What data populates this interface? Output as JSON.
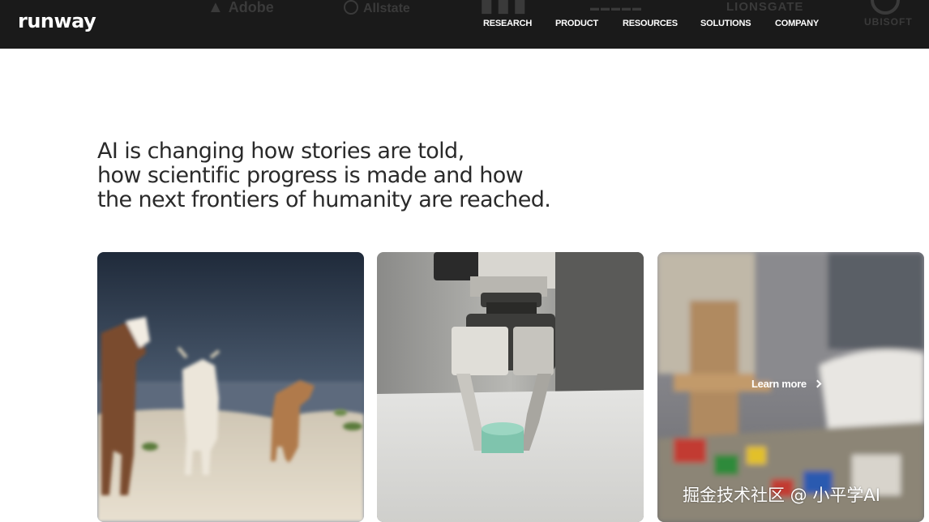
{
  "brand": {
    "logo_text": "runway"
  },
  "partners": [
    {
      "name": "Adobe"
    },
    {
      "name": "Allstate"
    },
    {
      "name": "LIONSGATE"
    },
    {
      "name": "UBISOFT"
    }
  ],
  "nav": {
    "items": [
      "RESEARCH",
      "PRODUCT",
      "RESOURCES",
      "SOLUTIONS",
      "COMPANY"
    ]
  },
  "hero": {
    "lines": [
      "AI is changing how stories are told,",
      "how scientific progress is made and how",
      "the next frontiers of humanity are reached."
    ]
  },
  "cards": [
    {
      "subject": "goats-on-beach"
    },
    {
      "subject": "robotic-gripper"
    },
    {
      "subject": "toy-room",
      "cta_label": "Learn more"
    }
  ],
  "watermark": {
    "text": "掘金技术社区 @ 小平学AI"
  },
  "colors": {
    "header_bg": "#1a1a1a",
    "nav_text": "#ffffff",
    "hero_text": "#2a2a2a",
    "page_bg": "#ffffff"
  }
}
